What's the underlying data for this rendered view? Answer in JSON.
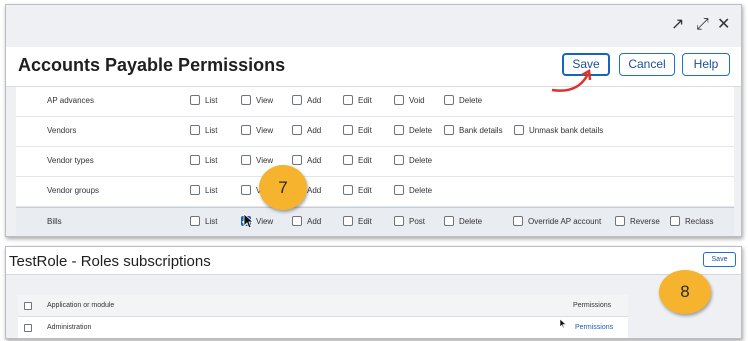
{
  "window_controls": {
    "external_link_icon": "↗",
    "expand_icon": "⤢",
    "close_icon": "✕"
  },
  "permissions_panel": {
    "title": "Accounts Payable Permissions",
    "buttons": {
      "save": "Save",
      "cancel": "Cancel",
      "help": "Help"
    },
    "rows": [
      {
        "label": "AP advances",
        "options": [
          {
            "label": "List",
            "checked": false
          },
          {
            "label": "View",
            "checked": false
          },
          {
            "label": "Add",
            "checked": false
          },
          {
            "label": "Edit",
            "checked": false
          },
          {
            "label": "Void",
            "checked": false
          },
          {
            "label": "Delete",
            "checked": false
          }
        ]
      },
      {
        "label": "Vendors",
        "options": [
          {
            "label": "List",
            "checked": false
          },
          {
            "label": "View",
            "checked": false
          },
          {
            "label": "Add",
            "checked": false
          },
          {
            "label": "Edit",
            "checked": false
          },
          {
            "label": "Delete",
            "checked": false
          },
          {
            "label": "Bank details",
            "checked": false
          },
          {
            "label": "Unmask bank details",
            "checked": false
          }
        ]
      },
      {
        "label": "Vendor types",
        "options": [
          {
            "label": "List",
            "checked": false
          },
          {
            "label": "View",
            "checked": false
          },
          {
            "label": "Add",
            "checked": false
          },
          {
            "label": "Edit",
            "checked": false
          },
          {
            "label": "Delete",
            "checked": false
          }
        ]
      },
      {
        "label": "Vendor groups",
        "options": [
          {
            "label": "List",
            "checked": false
          },
          {
            "label": "View",
            "checked": false
          },
          {
            "label": "Add",
            "checked": false
          },
          {
            "label": "Edit",
            "checked": false
          },
          {
            "label": "Delete",
            "checked": false
          }
        ]
      },
      {
        "label": "Bills",
        "options": [
          {
            "label": "List",
            "checked": false
          },
          {
            "label": "View",
            "checked": true
          },
          {
            "label": "Add",
            "checked": false
          },
          {
            "label": "Edit",
            "checked": false
          },
          {
            "label": "Post",
            "checked": false
          },
          {
            "label": "Delete",
            "checked": false
          },
          {
            "label": "Override AP account",
            "checked": false
          },
          {
            "label": "Reverse",
            "checked": false
          },
          {
            "label": "Reclass",
            "checked": false
          }
        ]
      }
    ]
  },
  "subscriptions_panel": {
    "title": "TestRole - Roles subscriptions",
    "save_label": "Save",
    "table": {
      "headers": {
        "module": "Application or module",
        "permissions": "Permissions"
      },
      "rows": [
        {
          "module": "Administration",
          "permissions_link": "Permissions"
        }
      ]
    }
  },
  "callouts": {
    "step7": "7",
    "step8": "8",
    "accent_color": "#f6b32d",
    "arrow_color": "#e0302a"
  }
}
